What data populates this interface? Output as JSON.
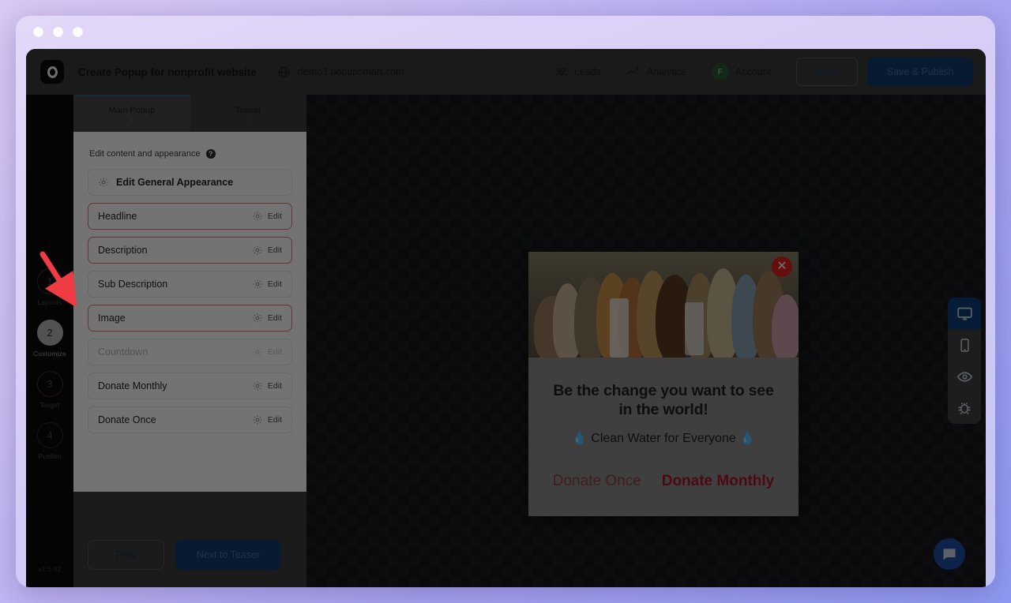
{
  "window": {
    "traffic_lights": [
      "close",
      "minimize",
      "maximize"
    ]
  },
  "topbar": {
    "app_title": "Create Popup for nonprofit website",
    "site_url": "demo3.popupsmart.com",
    "globe_icon": "globe-icon",
    "nav": [
      {
        "label": "Leads",
        "icon": "leads-icon"
      },
      {
        "label": "Analytics",
        "icon": "analytics-icon"
      }
    ],
    "account": {
      "label": "Account",
      "avatar_initial": "F",
      "avatar_color": "#2e5a3b"
    },
    "save_label": "Save",
    "save_publish_label": "Save & Publish"
  },
  "rail": {
    "steps": [
      {
        "number": "1",
        "name": "Layouts",
        "state": "done"
      },
      {
        "number": "2",
        "name": "Customize",
        "state": "active"
      },
      {
        "number": "3",
        "name": "Target",
        "state": "done"
      },
      {
        "number": "4",
        "name": "Publish",
        "state": "upcoming"
      }
    ],
    "version": "v1.5.92"
  },
  "panel": {
    "tabs": [
      {
        "label": "Main Popup",
        "active": true
      },
      {
        "label": "Teaser",
        "active": false
      }
    ],
    "section_title": "Edit content and appearance",
    "help_glyph": "?",
    "general_row": {
      "label": "Edit General Appearance",
      "icon": "gear-icon"
    },
    "edit_label": "Edit",
    "rows": [
      {
        "label": "Headline",
        "highlight": true,
        "disabled": false
      },
      {
        "label": "Description",
        "highlight": true,
        "disabled": false
      },
      {
        "label": "Sub Description",
        "highlight": false,
        "disabled": false
      },
      {
        "label": "Image",
        "highlight": true,
        "disabled": false
      },
      {
        "label": "Countdown",
        "highlight": false,
        "disabled": true
      },
      {
        "label": "Donate Monthly",
        "highlight": false,
        "disabled": false
      },
      {
        "label": "Donate Once",
        "highlight": false,
        "disabled": false
      }
    ],
    "prev_label": "Prev",
    "next_label": "Next to Teaser"
  },
  "preview": {
    "close_glyph": "✕",
    "headline": "Be the change you want to see in the world!",
    "subtitle": "💧 Clean Water for Everyone 💧",
    "donate_once_label": "Donate Once",
    "donate_monthly_label": "Donate Monthly"
  },
  "device_bar": {
    "buttons": [
      {
        "icon": "desktop-icon",
        "active": true,
        "marker": "#4f8f4a"
      },
      {
        "icon": "mobile-icon",
        "active": false,
        "marker": "#b33b4e"
      },
      {
        "icon": "eye-icon",
        "active": false,
        "marker": ""
      },
      {
        "icon": "bug-icon",
        "active": false,
        "marker": ""
      }
    ]
  },
  "chat": {
    "icon": "chat-icon"
  },
  "annotation": {
    "arrow": "red-arrow-pointing-to-step-2",
    "color": "#ef3b42"
  }
}
